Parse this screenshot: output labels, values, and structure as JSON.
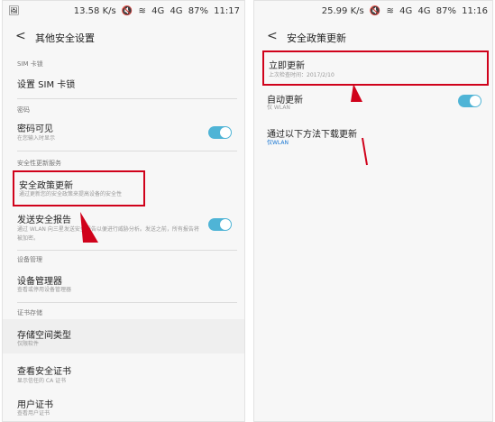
{
  "left_screen": {
    "status": {
      "speed": "13.58 K/s",
      "net1": "4G",
      "net2": "4G",
      "battery": "87%",
      "time": "11:17"
    },
    "title": "其他安全设置",
    "sections": {
      "sim": "SIM 卡锁",
      "password": "密码",
      "policy": "安全性更新服务",
      "device": "设备管理",
      "cred": "证书存储"
    },
    "items": {
      "sim_lock": {
        "title": "设置 SIM 卡锁"
      },
      "pwd_visible": {
        "title": "密码可见",
        "subtitle": "在您输入时显示",
        "toggle": true
      },
      "policy_update": {
        "title": "安全政策更新",
        "subtitle": "通过更新您的安全政策来提高设备的安全性"
      },
      "send_report": {
        "title": "发送安全报告",
        "subtitle": "通过 WLAN 向三星发送安全报告以便进行威胁分析。发送之前，所有报告将被加密。",
        "toggle": true
      },
      "device_admin": {
        "title": "设备管理器",
        "subtitle": "查看或停用设备管理器"
      },
      "storage_type": {
        "title": "存储空间类型",
        "subtitle": "仅限软件"
      },
      "view_certs": {
        "title": "查看安全证书",
        "subtitle": "显示信任的 CA 证书"
      },
      "user_certs": {
        "title": "用户证书",
        "subtitle": "查看用户证书"
      }
    }
  },
  "right_screen": {
    "status": {
      "speed": "25.99 K/s",
      "net1": "4G",
      "net2": "4G",
      "battery": "87%",
      "time": "11:16"
    },
    "title": "安全政策更新",
    "items": {
      "update_now": {
        "title": "立即更新",
        "subtitle": "上次检查时间：2017/2/10"
      },
      "auto_update": {
        "title": "自动更新",
        "subtitle": "仅 WLAN",
        "toggle": true
      },
      "download_via": {
        "title": "通过以下方法下载更新",
        "subtitle": "仅WLAN"
      }
    }
  },
  "colors": {
    "accent": "#4fb4d6",
    "annotation": "#d0021b"
  }
}
